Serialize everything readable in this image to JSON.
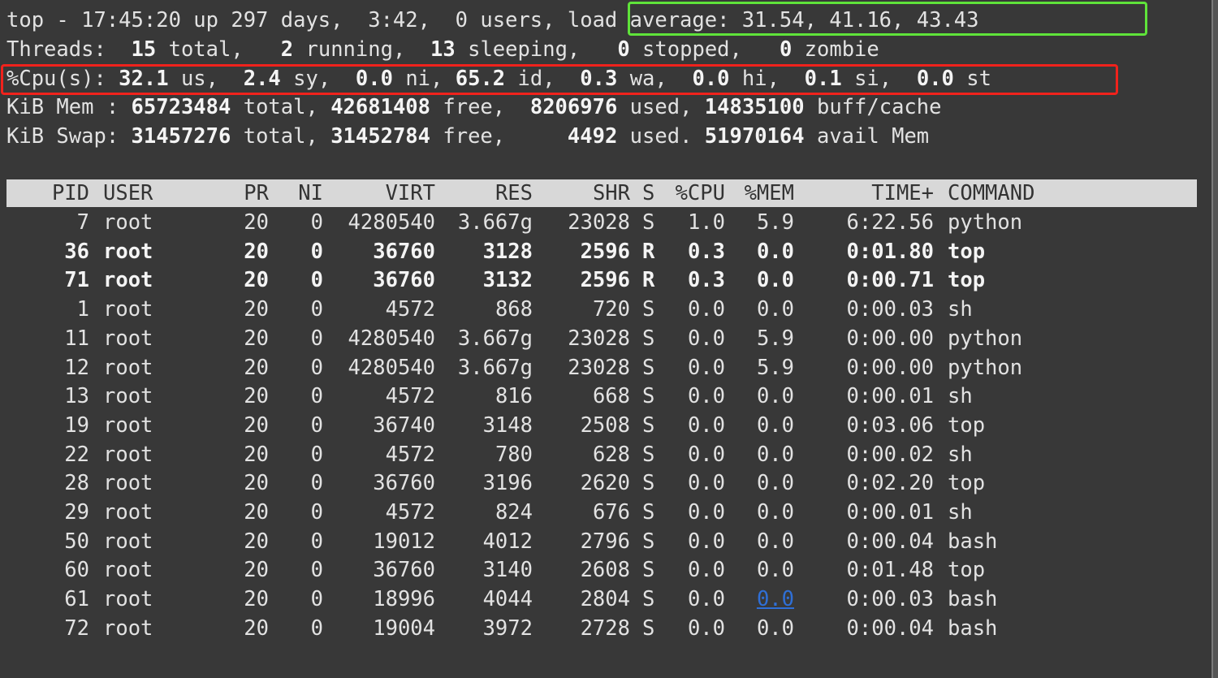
{
  "summary": {
    "line1_prefix": "top - 17:45:20 up 297 days,  3:42,  0 users,",
    "load_average": "load average: 31.54, 41.16, 43.43",
    "threads": {
      "label": "Threads: ",
      "total": "15",
      "total_label": " total,",
      "running": "2",
      "running_label": " running,",
      "sleeping": "13",
      "sleeping_label": " sleeping,",
      "stopped": "0",
      "stopped_label": " stopped,",
      "zombie": "0",
      "zombie_label": " zombie"
    },
    "cpu": {
      "label": "%Cpu(s): ",
      "us": "32.1",
      "sy": "2.4",
      "ni": "0.0",
      "id": "65.2",
      "wa": "0.3",
      "hi": "0.0",
      "si": "0.1",
      "st": "0.0"
    },
    "mem": {
      "label": "KiB Mem : ",
      "total": "65723484",
      "free": "42681408",
      "used": "8206976",
      "buff_cache": "14835100"
    },
    "swap": {
      "label": "KiB Swap: ",
      "total": "31457276",
      "free": "31452784",
      "used": "4492",
      "avail_mem": "51970164"
    }
  },
  "table": {
    "columns": [
      "PID",
      "USER",
      "PR",
      "NI",
      "VIRT",
      "RES",
      "SHR",
      "S",
      "%CPU",
      "%MEM",
      "TIME+",
      "COMMAND"
    ],
    "rows": [
      {
        "pid": "7",
        "user": "root",
        "pr": "20",
        "ni": "0",
        "virt": "4280540",
        "res": "3.667g",
        "shr": "23028",
        "s": "S",
        "cpu": "1.0",
        "mem": "5.9",
        "time": "6:22.56",
        "cmd": "python",
        "bold": false
      },
      {
        "pid": "36",
        "user": "root",
        "pr": "20",
        "ni": "0",
        "virt": "36760",
        "res": "3128",
        "shr": "2596",
        "s": "R",
        "cpu": "0.3",
        "mem": "0.0",
        "time": "0:01.80",
        "cmd": "top",
        "bold": true
      },
      {
        "pid": "71",
        "user": "root",
        "pr": "20",
        "ni": "0",
        "virt": "36760",
        "res": "3132",
        "shr": "2596",
        "s": "R",
        "cpu": "0.3",
        "mem": "0.0",
        "time": "0:00.71",
        "cmd": "top",
        "bold": true
      },
      {
        "pid": "1",
        "user": "root",
        "pr": "20",
        "ni": "0",
        "virt": "4572",
        "res": "868",
        "shr": "720",
        "s": "S",
        "cpu": "0.0",
        "mem": "0.0",
        "time": "0:00.03",
        "cmd": "sh",
        "bold": false
      },
      {
        "pid": "11",
        "user": "root",
        "pr": "20",
        "ni": "0",
        "virt": "4280540",
        "res": "3.667g",
        "shr": "23028",
        "s": "S",
        "cpu": "0.0",
        "mem": "5.9",
        "time": "0:00.00",
        "cmd": "python",
        "bold": false
      },
      {
        "pid": "12",
        "user": "root",
        "pr": "20",
        "ni": "0",
        "virt": "4280540",
        "res": "3.667g",
        "shr": "23028",
        "s": "S",
        "cpu": "0.0",
        "mem": "5.9",
        "time": "0:00.00",
        "cmd": "python",
        "bold": false
      },
      {
        "pid": "13",
        "user": "root",
        "pr": "20",
        "ni": "0",
        "virt": "4572",
        "res": "816",
        "shr": "668",
        "s": "S",
        "cpu": "0.0",
        "mem": "0.0",
        "time": "0:00.01",
        "cmd": "sh",
        "bold": false
      },
      {
        "pid": "19",
        "user": "root",
        "pr": "20",
        "ni": "0",
        "virt": "36740",
        "res": "3148",
        "shr": "2508",
        "s": "S",
        "cpu": "0.0",
        "mem": "0.0",
        "time": "0:03.06",
        "cmd": "top",
        "bold": false
      },
      {
        "pid": "22",
        "user": "root",
        "pr": "20",
        "ni": "0",
        "virt": "4572",
        "res": "780",
        "shr": "628",
        "s": "S",
        "cpu": "0.0",
        "mem": "0.0",
        "time": "0:00.02",
        "cmd": "sh",
        "bold": false
      },
      {
        "pid": "28",
        "user": "root",
        "pr": "20",
        "ni": "0",
        "virt": "36760",
        "res": "3196",
        "shr": "2620",
        "s": "S",
        "cpu": "0.0",
        "mem": "0.0",
        "time": "0:02.20",
        "cmd": "top",
        "bold": false
      },
      {
        "pid": "29",
        "user": "root",
        "pr": "20",
        "ni": "0",
        "virt": "4572",
        "res": "824",
        "shr": "676",
        "s": "S",
        "cpu": "0.0",
        "mem": "0.0",
        "time": "0:00.01",
        "cmd": "sh",
        "bold": false
      },
      {
        "pid": "50",
        "user": "root",
        "pr": "20",
        "ni": "0",
        "virt": "19012",
        "res": "4012",
        "shr": "2796",
        "s": "S",
        "cpu": "0.0",
        "mem": "0.0",
        "time": "0:00.04",
        "cmd": "bash",
        "bold": false
      },
      {
        "pid": "60",
        "user": "root",
        "pr": "20",
        "ni": "0",
        "virt": "36760",
        "res": "3140",
        "shr": "2608",
        "s": "S",
        "cpu": "0.0",
        "mem": "0.0",
        "time": "0:01.48",
        "cmd": "top",
        "bold": false
      },
      {
        "pid": "61",
        "user": "root",
        "pr": "20",
        "ni": "0",
        "virt": "18996",
        "res": "4044",
        "shr": "2804",
        "s": "S",
        "cpu": "0.0",
        "mem": "0.0",
        "time": "0:00.03",
        "cmd": "bash",
        "bold": false,
        "mem_link": true
      },
      {
        "pid": "72",
        "user": "root",
        "pr": "20",
        "ni": "0",
        "virt": "19004",
        "res": "3972",
        "shr": "2728",
        "s": "S",
        "cpu": "0.0",
        "mem": "0.0",
        "time": "0:00.04",
        "cmd": "bash",
        "bold": false
      }
    ]
  },
  "highlights": {
    "load_average_box_color": "#5fe33a",
    "cpu_line_box_color": "#f0221c",
    "link_color": "#2f6fd6"
  }
}
